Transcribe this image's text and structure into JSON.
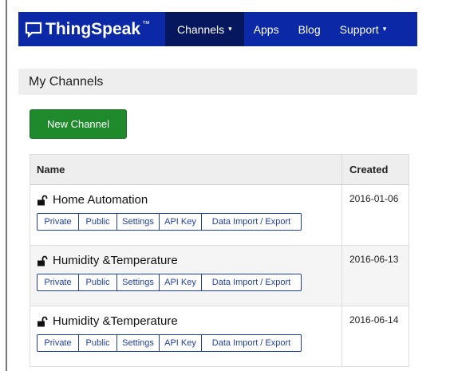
{
  "navbar": {
    "brand": "ThingSpeak",
    "brand_tm": "™",
    "brand_icon": "chat-bubble-icon",
    "items": [
      {
        "label": "Channels",
        "caret": "▾"
      },
      {
        "label": "Apps"
      },
      {
        "label": "Blog"
      },
      {
        "label": "Support",
        "caret": "▾"
      }
    ],
    "colors": {
      "background": "#0b28a6",
      "active": "#06175e"
    }
  },
  "page": {
    "title": "My Channels",
    "new_channel_label": "New Channel"
  },
  "table": {
    "headers": {
      "name": "Name",
      "created": "Created"
    },
    "rows": [
      {
        "name": "Home Automation",
        "created": "2016-01-06",
        "lock_icon": "unlocked-padlock-icon",
        "actions": [
          "Private",
          "Public",
          "Settings",
          "API Key",
          "Data Import / Export"
        ]
      },
      {
        "name": "Humidity &Temperature",
        "created": "2016-06-13",
        "lock_icon": "unlocked-padlock-icon",
        "actions": [
          "Private",
          "Public",
          "Settings",
          "API Key",
          "Data Import / Export"
        ]
      },
      {
        "name": "Humidity &Temperature",
        "created": "2016-06-14",
        "lock_icon": "unlocked-padlock-icon",
        "actions": [
          "Private",
          "Public",
          "Settings",
          "API Key",
          "Data Import / Export"
        ]
      }
    ]
  },
  "colors": {
    "new_channel_button": "#1f8a2c",
    "action_button_border": "#1f3fa8"
  }
}
